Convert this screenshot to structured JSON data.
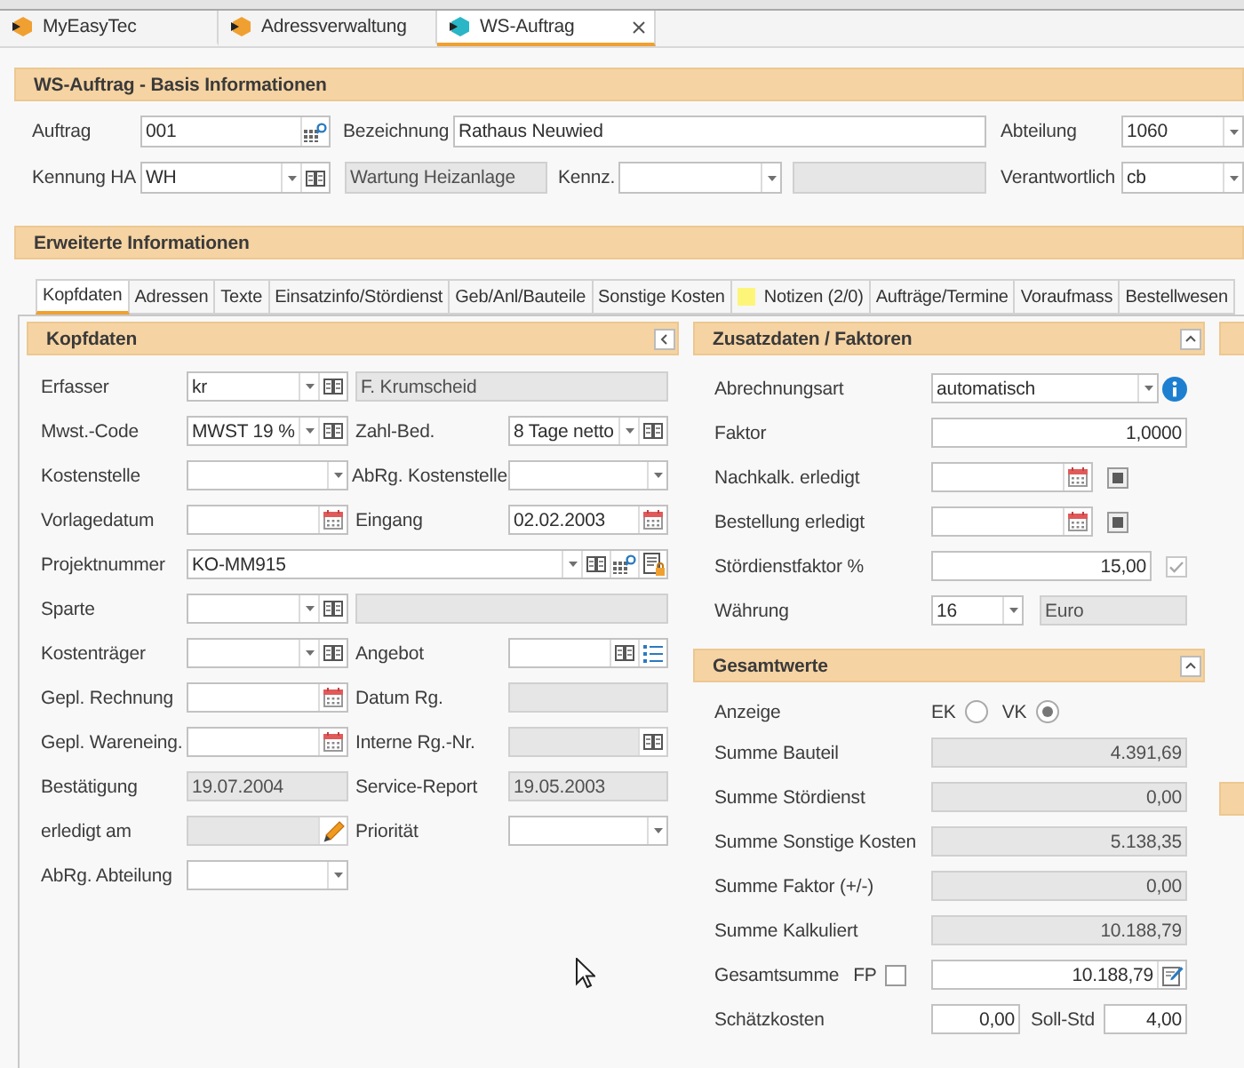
{
  "doc_tabs": [
    {
      "label": "MyEasyTec",
      "color": "#f0a030",
      "selected": false,
      "closable": false
    },
    {
      "label": "Adressverwaltung",
      "color": "#f0a030",
      "selected": false,
      "closable": false
    },
    {
      "label": "WS-Auftrag",
      "color": "#29b6c6",
      "selected": true,
      "closable": true
    }
  ],
  "basis": {
    "title": "WS-Auftrag - Basis Informationen",
    "auftrag": {
      "label": "Auftrag",
      "value": "001"
    },
    "bezeichnung": {
      "label": "Bezeichnung",
      "value": "Rathaus Neuwied"
    },
    "abteilung": {
      "label": "Abteilung",
      "value": "1060"
    },
    "kennung_ha": {
      "label": "Kennung HA",
      "value": "WH",
      "description": "Wartung Heizanlage"
    },
    "kennz": {
      "label": "Kennz."
    },
    "verantwortlich": {
      "label": "Verantwortlich",
      "value": "cb"
    }
  },
  "erweitert": {
    "title": "Erweiterte Informationen",
    "tabs": [
      {
        "label": "Kopfdaten",
        "kind": "plain",
        "selected": true
      },
      {
        "label": "Adressen",
        "kind": "plain",
        "selected": false
      },
      {
        "label": "Texte",
        "kind": "plain",
        "selected": false
      },
      {
        "label": "Einsatzinfo/Stördienst",
        "kind": "plain",
        "selected": false
      },
      {
        "label": "Geb/Anl/Bauteile",
        "kind": "plain",
        "selected": false
      },
      {
        "label": "Sonstige Kosten",
        "kind": "plain",
        "selected": false
      },
      {
        "label": "Notizen (2/0)",
        "kind": "note",
        "selected": false
      },
      {
        "label": "Aufträge/Termine",
        "kind": "plain",
        "selected": false
      },
      {
        "label": "Voraufmass",
        "kind": "plain",
        "selected": false
      },
      {
        "label": "Bestellwesen",
        "kind": "plain",
        "selected": false
      }
    ]
  },
  "kopfdaten": {
    "title": "Kopfdaten",
    "erfasser": {
      "label": "Erfasser",
      "value": "kr",
      "name": "F. Krumscheid"
    },
    "mwst_code": {
      "label": "Mwst.-Code",
      "value": "MWST 19 %"
    },
    "zahl_bed": {
      "label": "Zahl-Bed.",
      "value": "8 Tage netto"
    },
    "kostenstelle": {
      "label": "Kostenstelle"
    },
    "abrg_kostenstelle": {
      "label": "AbRg. Kostenstelle"
    },
    "vorlagedatum": {
      "label": "Vorlagedatum"
    },
    "eingang": {
      "label": "Eingang",
      "value": "02.02.2003"
    },
    "projektnummer": {
      "label": "Projektnummer",
      "value": "KO-MM915"
    },
    "sparte": {
      "label": "Sparte"
    },
    "kostentraeger": {
      "label": "Kostenträger"
    },
    "angebot": {
      "label": "Angebot"
    },
    "gepl_rechnung": {
      "label": "Gepl. Rechnung"
    },
    "datum_rg": {
      "label": "Datum Rg."
    },
    "gepl_wareneing": {
      "label": "Gepl. Wareneing."
    },
    "interne_rg_nr": {
      "label": "Interne Rg.-Nr."
    },
    "bestaetigung": {
      "label": "Bestätigung",
      "value": "19.07.2004"
    },
    "service_report": {
      "label": "Service-Report",
      "value": "19.05.2003"
    },
    "erledigt_am": {
      "label": "erledigt am"
    },
    "prioritaet": {
      "label": "Priorität"
    },
    "abrg_abteilung": {
      "label": "AbRg. Abteilung"
    }
  },
  "zusatzdaten": {
    "title": "Zusatzdaten / Faktoren",
    "abrechnungsart": {
      "label": "Abrechnungsart",
      "value": "automatisch"
    },
    "faktor": {
      "label": "Faktor",
      "value": "1,0000"
    },
    "nachkalk_erledigt": {
      "label": "Nachkalk. erledigt",
      "indeterminate": true
    },
    "bestellung_erledigt": {
      "label": "Bestellung erledigt",
      "indeterminate": true
    },
    "stoerdienstfaktor": {
      "label": "Stördienstfaktor %",
      "value": "15,00",
      "checked": true,
      "disabled": true
    },
    "waehrung": {
      "label": "Währung",
      "value": "16",
      "name": "Euro"
    }
  },
  "gesamtwerte": {
    "title": "Gesamtwerte",
    "anzeige": {
      "label": "Anzeige",
      "options": [
        {
          "label": "EK",
          "selected": false
        },
        {
          "label": "VK",
          "selected": true
        }
      ]
    },
    "summen": [
      {
        "label": "Summe Bauteil",
        "value": "4.391,69"
      },
      {
        "label": "Summe Stördienst",
        "value": "0,00"
      },
      {
        "label": "Summe Sonstige Kosten",
        "value": "5.138,35"
      },
      {
        "label": "Summe Faktor (+/-)",
        "value": "0,00"
      },
      {
        "label": "Summe Kalkuliert",
        "value": "10.188,79"
      }
    ],
    "gesamtsumme": {
      "label": "Gesamtsumme",
      "fp_label": "FP",
      "fp_checked": false,
      "value": "10.188,79"
    },
    "schaetzkosten": {
      "label": "Schätzkosten",
      "value": "0,00"
    },
    "soll_std": {
      "label": "Soll-Std",
      "value": "4,00"
    }
  }
}
